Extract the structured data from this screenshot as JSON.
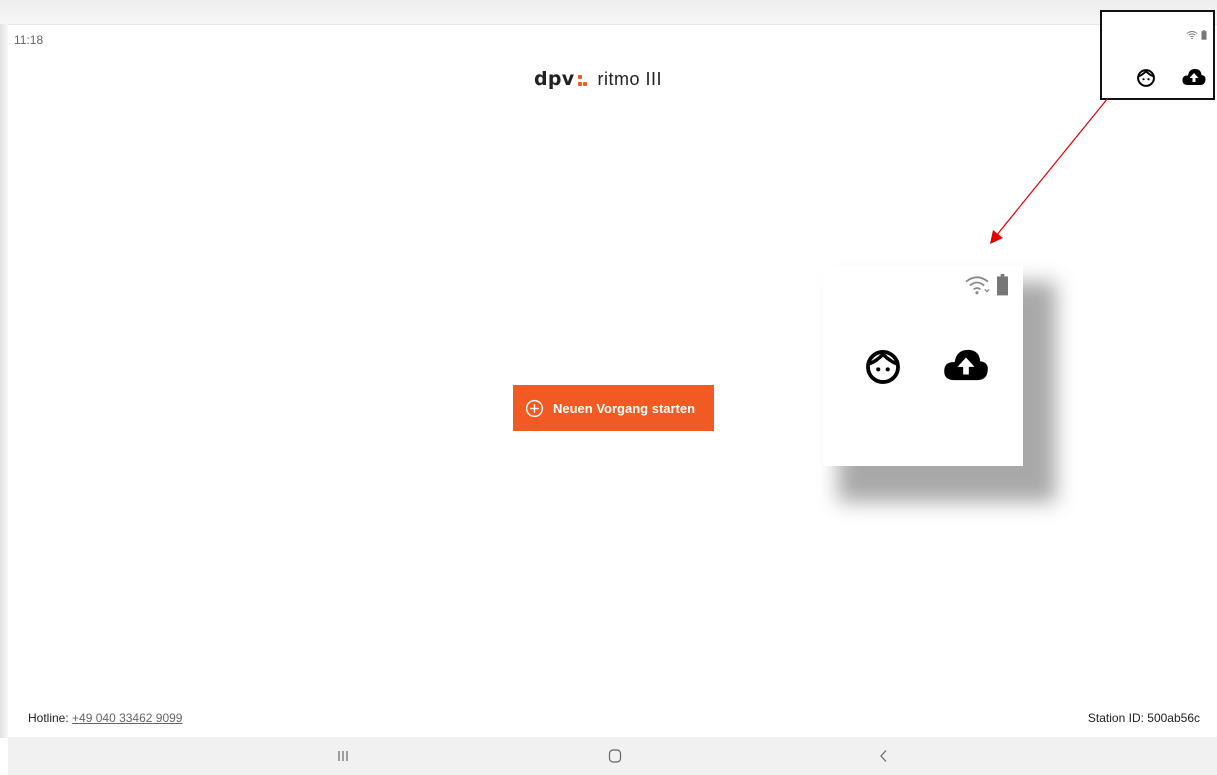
{
  "status": {
    "time": "11:18"
  },
  "header": {
    "logo_text": "dpv",
    "app_title": "ritmo III"
  },
  "main": {
    "start_button_label": "Neuen Vorgang starten"
  },
  "footer": {
    "hotline_label": "Hotline: ",
    "hotline_number": "+49 040 33462 9099",
    "station_id": "Station ID: 500ab56c"
  },
  "icons": {
    "wifi": "wifi-icon",
    "battery": "battery-icon",
    "face": "face-icon",
    "cloud_upload": "cloud-upload-icon",
    "plus": "plus-circle-icon",
    "nav_recent": "recent-apps-icon",
    "nav_home": "home-icon",
    "nav_back": "back-icon"
  },
  "colors": {
    "accent": "#f15a22",
    "annotation_arrow": "#e00000"
  }
}
